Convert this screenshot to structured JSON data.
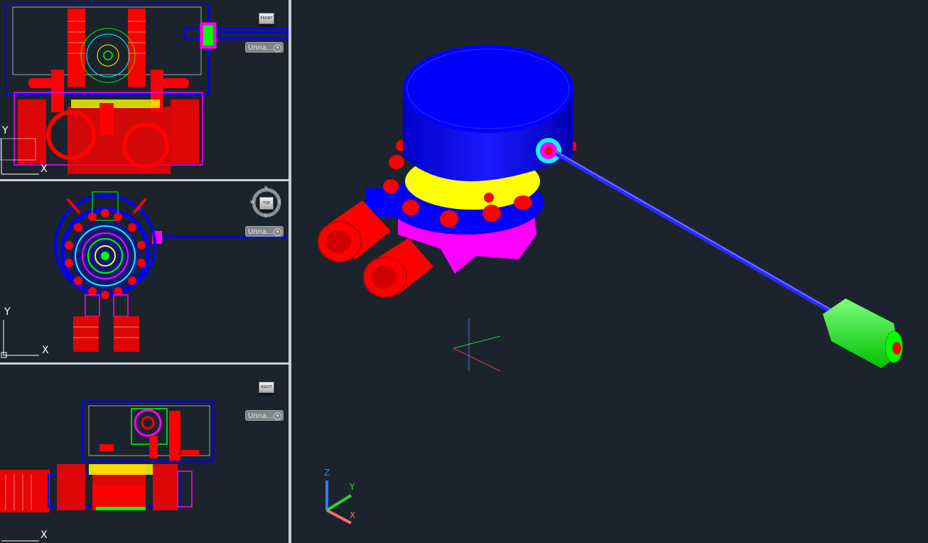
{
  "viewports": {
    "front": {
      "viewcube_label": "FRONT",
      "view_dropdown": "Unna...",
      "ucs_x": "X",
      "ucs_y": "Y"
    },
    "top": {
      "viewcube_label": "TOP",
      "view_dropdown": "Unna...",
      "compass": {
        "n": "N",
        "s": "S",
        "e": "E",
        "w": "W"
      },
      "ucs_x": "X",
      "ucs_y": "Y"
    },
    "right": {
      "viewcube_label": "RIGHT",
      "view_dropdown": "Unna...",
      "ucs_x": "X"
    },
    "iso": {
      "ucs_x": "X",
      "ucs_y": "Y",
      "ucs_z": "Z"
    }
  },
  "colors": {
    "background": "#1b242c",
    "blue": "#0000ff",
    "red": "#ff0000",
    "magenta": "#ff00ff",
    "yellow": "#ffff00",
    "green": "#00ff00",
    "cyan": "#00ffff"
  },
  "icons": [
    "viewcube-icon",
    "compass-icon",
    "ucs-icon",
    "chevron-down-icon"
  ]
}
